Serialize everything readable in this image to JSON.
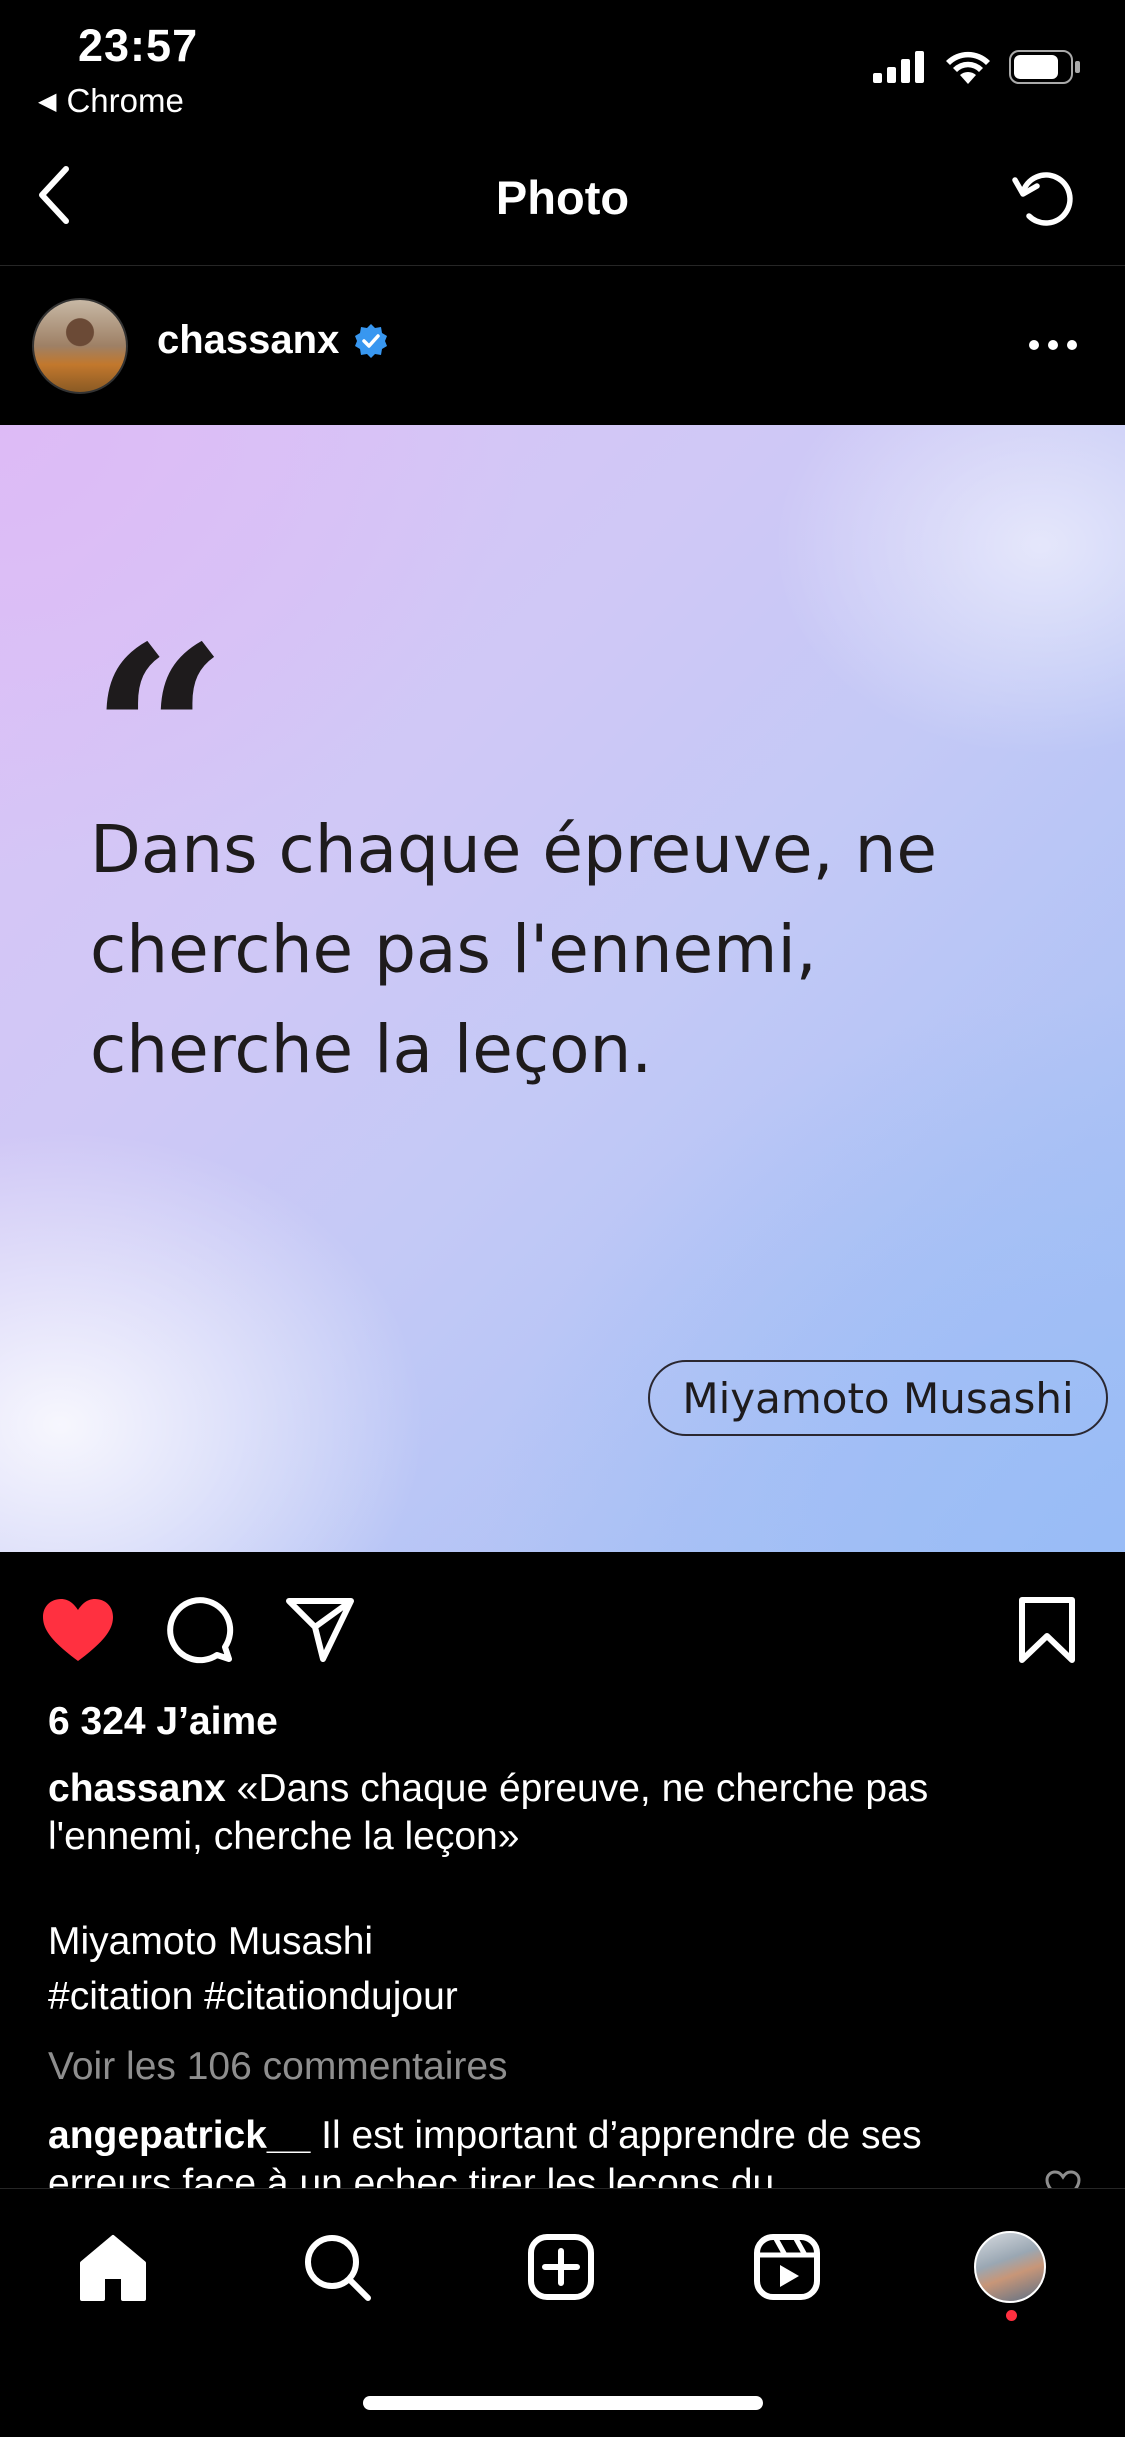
{
  "status_bar": {
    "time": "23:57",
    "back_app": "Chrome"
  },
  "nav": {
    "title": "Photo"
  },
  "post": {
    "username": "chassanx",
    "verified": true,
    "image": {
      "quote_mark": "“",
      "quote": "Dans chaque épreuve, ne cherche pas l'ennemi, cherche la leçon.",
      "author": "Miyamoto Musashi"
    },
    "liked": true,
    "likes": "6 324 J’aime",
    "caption_user": "chassanx",
    "caption_text": "«Dans chaque épreuve, ne cherche pas l'ennemi, cherche la leçon»",
    "caption_author": "Miyamoto Musashi",
    "caption_tags": "#citation #citationdujour",
    "view_comments": "Voir les 106 commentaires",
    "comment": {
      "user": "angepatrick__",
      "text": "Il est important d’apprendre de ses erreurs face à un echec tirer les leçons du"
    }
  },
  "colors": {
    "like_red": "#ff3040",
    "verified_blue": "#3897f0",
    "muted_text": "#8e8e8e"
  },
  "icons": [
    "back-icon",
    "refresh-icon",
    "more-icon",
    "heart-icon",
    "comment-icon",
    "share-icon",
    "bookmark-icon",
    "home-icon",
    "search-icon",
    "create-icon",
    "reels-icon"
  ]
}
